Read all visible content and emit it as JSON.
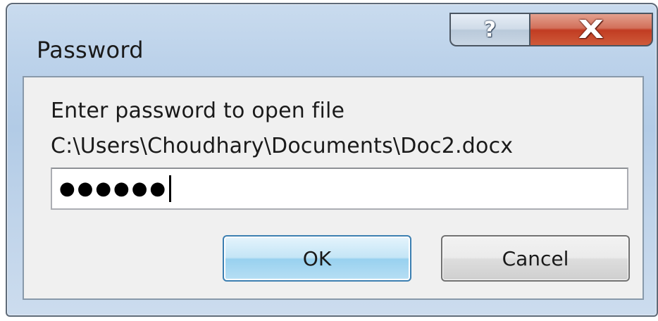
{
  "window": {
    "title": "Password",
    "help_glyph": "?",
    "close_glyph": "X"
  },
  "dialog": {
    "prompt": "Enter password to open file",
    "file_path": "C:\\Users\\Choudhary\\Documents\\Doc2.docx",
    "password_masked": "●●●●●●"
  },
  "buttons": {
    "ok_label": "OK",
    "cancel_label": "Cancel"
  },
  "colors": {
    "close_button": "#c13c22",
    "ok_button_border": "#3c7fb1",
    "title_bar": "#bcd2ea"
  }
}
